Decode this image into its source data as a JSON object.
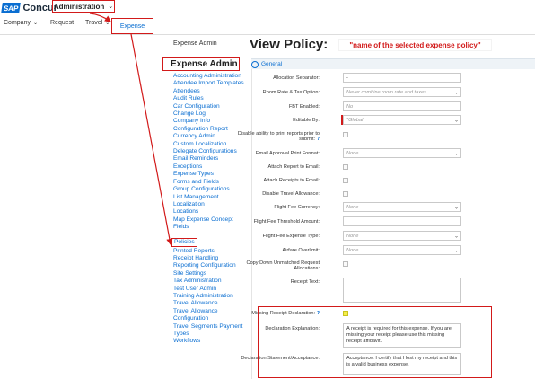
{
  "brand": {
    "badge": "SAP",
    "name": "Concur"
  },
  "top_menu": {
    "label": "Administration",
    "chevron": "chevron-down-icon"
  },
  "nav": {
    "company": "Company",
    "request": "Request",
    "travel": "Travel",
    "expense": "Expense"
  },
  "sidebar": {
    "small_heading": "Expense Admin",
    "big_heading": "Expense Admin",
    "items": [
      "Accounting Administration",
      "Attendee Import Templates",
      "Attendees",
      "Audit Rules",
      "Car Configuration",
      "Change Log",
      "Company Info",
      "Configuration Report",
      "Currency Admin",
      "Custom Localization",
      "Delegate Configurations",
      "Email Reminders",
      "Exceptions",
      "Expense Types",
      "Forms and Fields",
      "Group Configurations",
      "List Management",
      "Localization",
      "Locations",
      "Map Expense Concept Fields",
      "Policies",
      "Printed Reports",
      "Receipt Handling",
      "Reporting Configuration",
      "Site Settings",
      "Tax Administration",
      "Test User Admin",
      "Training Administration",
      "Travel Allowance",
      "Travel Allowance Configuration",
      "Travel Segments Payment Types",
      "Workflows"
    ]
  },
  "main": {
    "title": "View Policy:",
    "title_note": "\"name of the selected expense policy\"",
    "tab": "General"
  },
  "form": {
    "allocation_separator": {
      "label": "Allocation Separator:",
      "value": "-"
    },
    "room_rate": {
      "label": "Room Rate & Tax Option:",
      "value": "Never combine room rate and taxes"
    },
    "fbt_enabled": {
      "label": "FBT Enabled:",
      "value": "No"
    },
    "editable_by": {
      "label": "Editable By:",
      "value": "*Global"
    },
    "disable_print": {
      "label": "Disable ability to print reports prior to submit:"
    },
    "email_approval_print_format": {
      "label": "Email Approval Print Format:",
      "value": "None"
    },
    "attach_report_email": {
      "label": "Attach Report to Email:"
    },
    "attach_receipts_email": {
      "label": "Attach Receipts to Email:"
    },
    "disable_travel_allowance": {
      "label": "Disable Travel Allowance:"
    },
    "flight_fee_currency": {
      "label": "Flight Fee Currency:",
      "value": "None"
    },
    "flight_fee_threshold": {
      "label": "Flight Fee Threshold Amount:",
      "value": ""
    },
    "flight_fee_expense_type": {
      "label": "Flight Fee Expense Type:",
      "value": "None"
    },
    "airfare_overlimit": {
      "label": "Airfare Overlimit:",
      "value": "None"
    },
    "copy_down": {
      "label": "Copy Down Unmatched Request Allocations:"
    },
    "receipt_text": {
      "label": "Receipt Text:",
      "value": ""
    },
    "missing_receipt_declaration": {
      "label": "Missing Receipt Declaration:"
    },
    "declaration_explanation": {
      "label": "Declaration Explanation:",
      "value": "A receipt is required for this expense.  If you are missing your receipt please use this missing receipt affidavit."
    },
    "declaration_statement": {
      "label": "Declaration Statement/Acceptance:",
      "value": "Acceptance:  I certify that I lost my receipt and this is a valid business expense."
    }
  },
  "colors": {
    "accent": "#0a6ed1",
    "annotation_red": "#d21a1a",
    "checkbox_highlight": "#f4ee4a"
  }
}
